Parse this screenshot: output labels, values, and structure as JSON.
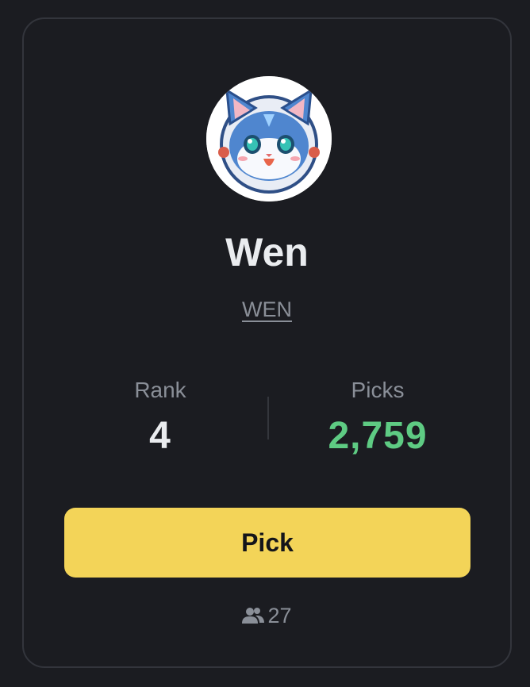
{
  "token": {
    "name": "Wen",
    "symbol": "WEN",
    "avatar_icon": "cat-astronaut-avatar"
  },
  "stats": {
    "rank_label": "Rank",
    "rank_value": "4",
    "picks_label": "Picks",
    "picks_value": "2,759"
  },
  "actions": {
    "pick_label": "Pick"
  },
  "participants": {
    "icon": "users-icon",
    "count": "27"
  },
  "colors": {
    "background": "#1b1c21",
    "card_border": "#33353c",
    "primary_text": "#eaecef",
    "muted_text": "#8a8f98",
    "positive": "#5ecb83",
    "button": "#f3d458",
    "button_text": "#14151a"
  }
}
